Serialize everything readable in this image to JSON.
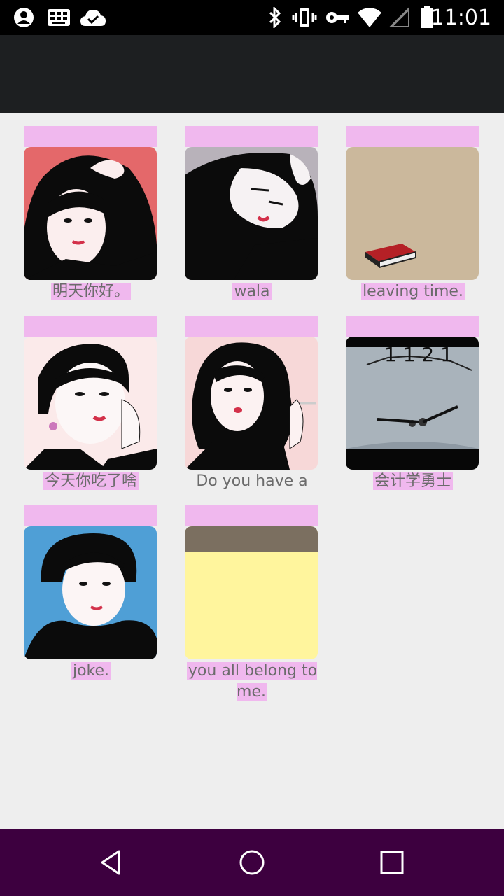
{
  "status_bar": {
    "time": "11:01",
    "icons": [
      "account-icon",
      "keyboard-icon",
      "cloud-check-icon",
      "bluetooth-icon",
      "vibrate-icon",
      "vpn-key-icon",
      "wifi-icon",
      "no-signal-icon",
      "battery-icon"
    ]
  },
  "grid": {
    "items": [
      {
        "caption": "明天你好。",
        "image": "woman-hands-on-head"
      },
      {
        "caption": "wala",
        "image": "woman-resting-head"
      },
      {
        "caption": "leaving time.",
        "image": "red-book-beige"
      },
      {
        "caption": "今天你吃了啥",
        "image": "woman-hand-on-cheek"
      },
      {
        "caption": "Do you have a",
        "image": "woman-with-cigarette"
      },
      {
        "caption": "会计学勇士",
        "image": "clock-face"
      },
      {
        "caption": "joke.",
        "image": "woman-blue-background"
      },
      {
        "caption": "you all belong to me.",
        "image": "yellow-note"
      }
    ]
  },
  "nav_bar": {
    "back": "back-icon",
    "home": "home-icon",
    "recents": "recents-icon"
  },
  "colors": {
    "status_bar": "#000000",
    "app_bar": "#1d1f21",
    "background": "#eeeeee",
    "accent_pink": "#f0b8ee",
    "nav_bar": "#3d003f"
  }
}
